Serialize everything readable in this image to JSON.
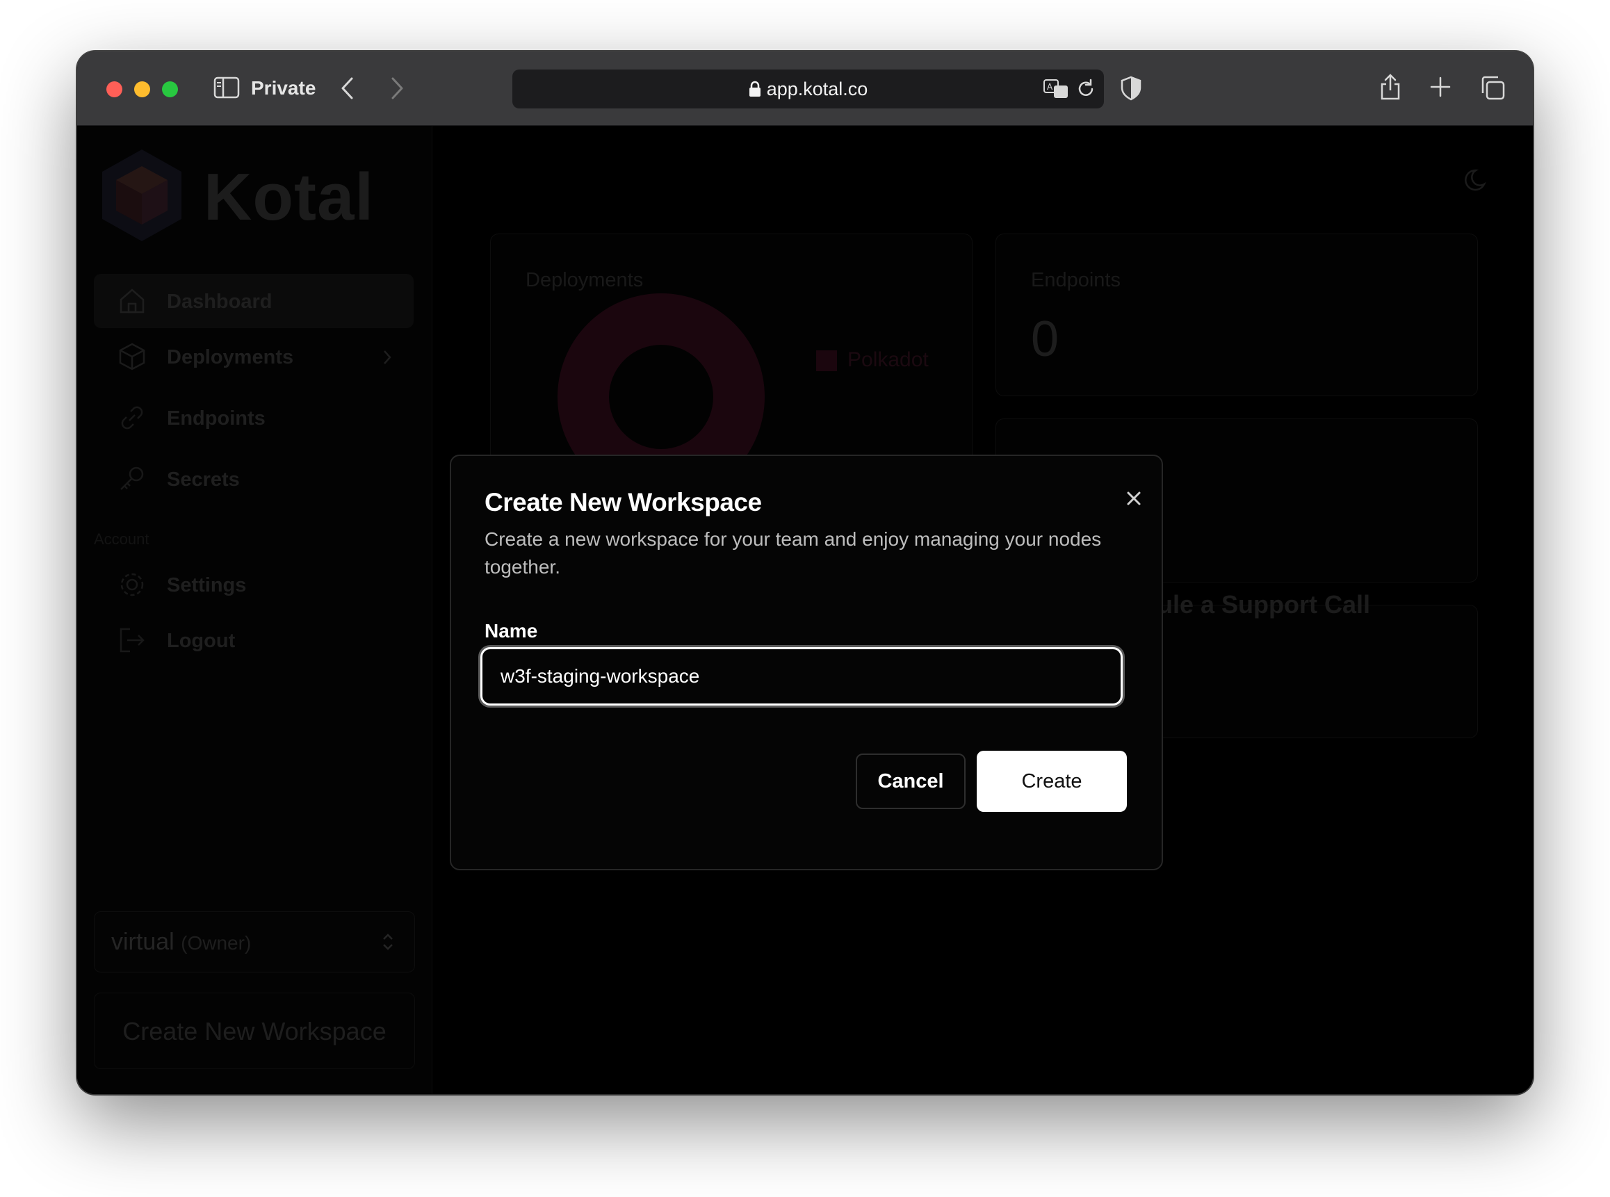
{
  "browser": {
    "mode_label": "Private",
    "url": "app.kotal.co",
    "icons": [
      "sidebar-toggle-icon",
      "back-chevron-icon",
      "forward-chevron-icon",
      "lock-icon",
      "translate-icon",
      "reload-icon",
      "shield-icon",
      "share-icon",
      "new-tab-plus-icon",
      "tabs-overview-icon"
    ]
  },
  "sidebar": {
    "logo_text": "Kotal",
    "nav": [
      {
        "label": "Dashboard",
        "icon": "home-icon",
        "active": true
      },
      {
        "label": "Deployments",
        "icon": "cube-icon"
      },
      {
        "label": "Endpoints",
        "icon": "link-icon"
      },
      {
        "label": "Secrets",
        "icon": "key-icon"
      }
    ],
    "account_section_label": "Account",
    "account_nav": [
      {
        "label": "Settings",
        "icon": "gear-icon"
      },
      {
        "label": "Logout",
        "icon": "logout-icon"
      }
    ],
    "workspace": {
      "name": "virtual",
      "role": "(Owner)"
    },
    "create_workspace_label": "Create New Workspace"
  },
  "dashboard": {
    "deployments_title": "Deployments",
    "legend_label": "Polkadot",
    "endpoints_title": "Endpoints",
    "endpoints_value": "0",
    "support_label": "ule a Support Call"
  },
  "modal": {
    "title": "Create New Workspace",
    "description": "Create a new workspace for your team and enjoy managing your nodes together.",
    "name_label": "Name",
    "name_value": "w3f-staging-workspace",
    "cancel_label": "Cancel",
    "create_label": "Create"
  },
  "colors": {
    "accent_dark": "#2a0a16",
    "chrome": "#3a3a3c",
    "modal_bg": "#050505"
  }
}
